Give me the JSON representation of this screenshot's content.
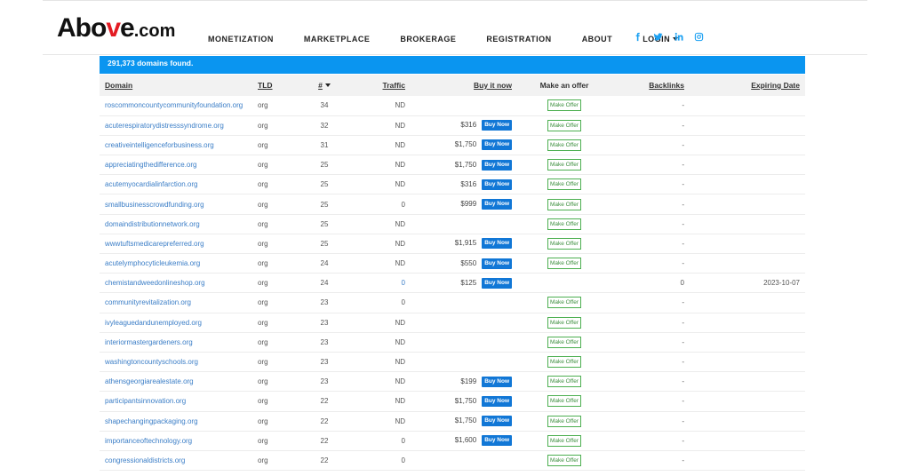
{
  "logo": {
    "main": "Above",
    "dot": ".com",
    "accent_color": "#e31b23"
  },
  "nav": [
    {
      "label": "MONETIZATION",
      "has_caret": false
    },
    {
      "label": "MARKETPLACE",
      "has_caret": false
    },
    {
      "label": "BROKERAGE",
      "has_caret": false
    },
    {
      "label": "REGISTRATION",
      "has_caret": false
    },
    {
      "label": "ABOUT",
      "has_caret": false
    },
    {
      "label": "LOGIN",
      "has_caret": true
    }
  ],
  "social": [
    {
      "icon": "facebook-icon",
      "color": "#1da1f2"
    },
    {
      "icon": "twitter-icon",
      "color": "#1da1f2"
    },
    {
      "icon": "linkedin-icon",
      "color": "#1da1f2"
    },
    {
      "icon": "instagram-icon",
      "color": "#1da1f2"
    }
  ],
  "banner": {
    "text": "291,373 domains found.",
    "color": "#0a95f0"
  },
  "table": {
    "columns": {
      "domain": "Domain",
      "tld": "TLD",
      "num": "#",
      "traffic": "Traffic",
      "buy": "Buy it now",
      "offer": "Make an offer",
      "backlinks": "Backlinks",
      "expiring": "Expiring Date"
    },
    "buy_label": "Buy Now",
    "offer_label": "Make Offer",
    "rows": [
      {
        "domain": "roscommoncountycommunityfoundation.org",
        "tld": "org",
        "num": "34",
        "traffic": "ND",
        "price": "",
        "offer": true,
        "backlinks": "-",
        "expiring": ""
      },
      {
        "domain": "acuterespiratorydistresssyndrome.org",
        "tld": "org",
        "num": "32",
        "traffic": "ND",
        "price": "$316",
        "offer": true,
        "backlinks": "-",
        "expiring": ""
      },
      {
        "domain": "creativeintelligenceforbusiness.org",
        "tld": "org",
        "num": "31",
        "traffic": "ND",
        "price": "$1,750",
        "offer": true,
        "backlinks": "-",
        "expiring": ""
      },
      {
        "domain": "appreciatingthedifference.org",
        "tld": "org",
        "num": "25",
        "traffic": "ND",
        "price": "$1,750",
        "offer": true,
        "backlinks": "-",
        "expiring": ""
      },
      {
        "domain": "acutemyocardialinfarction.org",
        "tld": "org",
        "num": "25",
        "traffic": "ND",
        "price": "$316",
        "offer": true,
        "backlinks": "-",
        "expiring": ""
      },
      {
        "domain": "smallbusinesscrowdfunding.org",
        "tld": "org",
        "num": "25",
        "traffic": "0",
        "price": "$999",
        "offer": true,
        "backlinks": "-",
        "expiring": ""
      },
      {
        "domain": "domaindistributionnetwork.org",
        "tld": "org",
        "num": "25",
        "traffic": "ND",
        "price": "",
        "offer": true,
        "backlinks": "-",
        "expiring": ""
      },
      {
        "domain": "wwwtuftsmedicarepreferred.org",
        "tld": "org",
        "num": "25",
        "traffic": "ND",
        "price": "$1,915",
        "offer": true,
        "backlinks": "-",
        "expiring": ""
      },
      {
        "domain": "acutelymphocyticleukemia.org",
        "tld": "org",
        "num": "24",
        "traffic": "ND",
        "price": "$550",
        "offer": true,
        "backlinks": "-",
        "expiring": ""
      },
      {
        "domain": "chemistandweedonlineshop.org",
        "tld": "org",
        "num": "24",
        "traffic": "0",
        "traffic_link": true,
        "price": "$125",
        "offer": false,
        "backlinks": "0",
        "expiring": "2023-10-07"
      },
      {
        "domain": "communityrevitalization.org",
        "tld": "org",
        "num": "23",
        "traffic": "0",
        "price": "",
        "offer": true,
        "backlinks": "-",
        "expiring": ""
      },
      {
        "domain": "ivyleaguedandunemployed.org",
        "tld": "org",
        "num": "23",
        "traffic": "ND",
        "price": "",
        "offer": true,
        "backlinks": "-",
        "expiring": ""
      },
      {
        "domain": "interiormastergardeners.org",
        "tld": "org",
        "num": "23",
        "traffic": "ND",
        "price": "",
        "offer": true,
        "backlinks": "-",
        "expiring": ""
      },
      {
        "domain": "washingtoncountyschools.org",
        "tld": "org",
        "num": "23",
        "traffic": "ND",
        "price": "",
        "offer": true,
        "backlinks": "-",
        "expiring": ""
      },
      {
        "domain": "athensgeorgiarealestate.org",
        "tld": "org",
        "num": "23",
        "traffic": "ND",
        "price": "$199",
        "offer": true,
        "backlinks": "-",
        "expiring": ""
      },
      {
        "domain": "participantsinnovation.org",
        "tld": "org",
        "num": "22",
        "traffic": "ND",
        "price": "$1,750",
        "offer": true,
        "backlinks": "-",
        "expiring": ""
      },
      {
        "domain": "shapechangingpackaging.org",
        "tld": "org",
        "num": "22",
        "traffic": "ND",
        "price": "$1,750",
        "offer": true,
        "backlinks": "-",
        "expiring": ""
      },
      {
        "domain": "importanceoftechnology.org",
        "tld": "org",
        "num": "22",
        "traffic": "0",
        "price": "$1,600",
        "offer": true,
        "backlinks": "-",
        "expiring": ""
      },
      {
        "domain": "congressionaldistricts.org",
        "tld": "org",
        "num": "22",
        "traffic": "0",
        "price": "",
        "offer": true,
        "backlinks": "-",
        "expiring": ""
      }
    ]
  }
}
